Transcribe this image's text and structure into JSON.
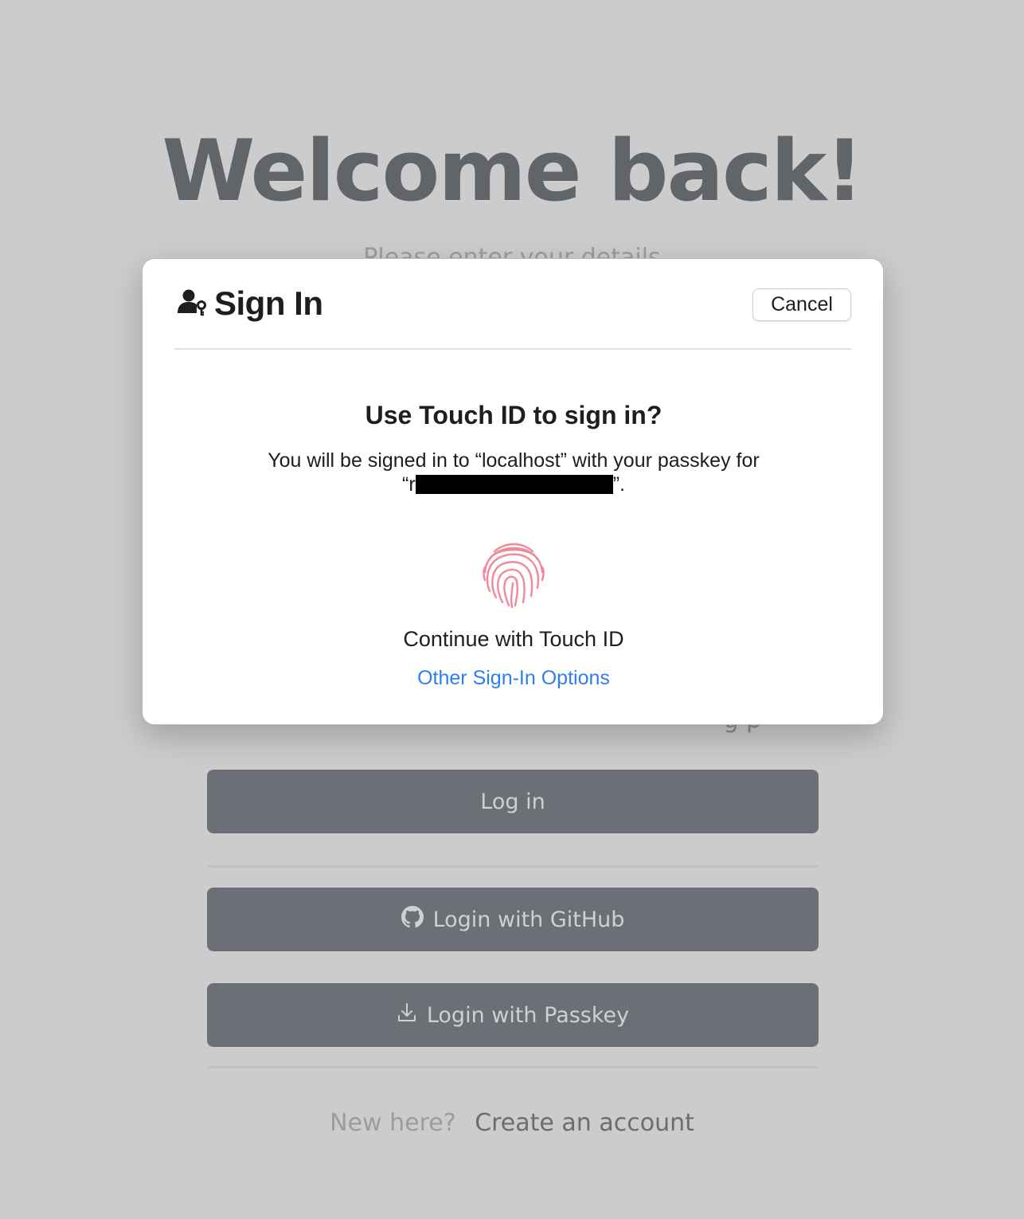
{
  "background": {
    "heading": "Welcome back!",
    "subtitle": "Please enter your details",
    "hint_text": "g p",
    "login_button": "Log in",
    "github_button": "Login with GitHub",
    "passkey_button": "Login with Passkey",
    "signup_prompt": "New here?",
    "signup_link": "Create an account"
  },
  "modal": {
    "title": "Sign In",
    "cancel_label": "Cancel",
    "prompt_title": "Use Touch ID to sign in?",
    "prompt_line1": "You will be signed in to “localhost” with your passkey for",
    "prompt_line2_prefix": "“r",
    "prompt_line2_suffix": "”.",
    "continue_text": "Continue with Touch ID",
    "other_options": "Other Sign-In Options"
  },
  "icons": {
    "title_icon": "person-key-icon",
    "fingerprint_icon": "fingerprint-icon",
    "github_icon": "github-icon",
    "passkey_icon": "download-icon"
  },
  "colors": {
    "overlay_background": "#cccccc",
    "link_blue": "#2f7ef0",
    "fingerprint_pink": "#f08a9a",
    "dimmed_button": "#6c6f75"
  }
}
